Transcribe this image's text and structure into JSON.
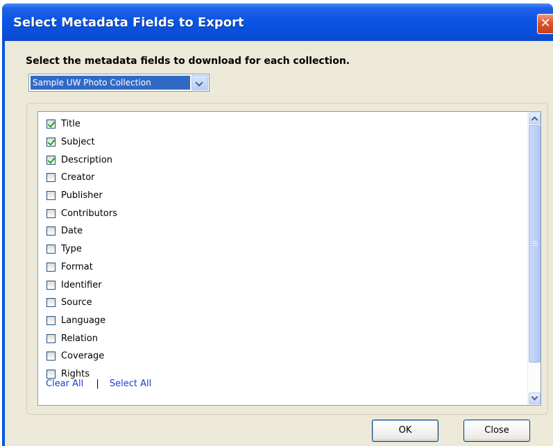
{
  "window": {
    "title": "Select Metadata Fields to Export",
    "close_glyph": "✕"
  },
  "instructions": "Select the metadata fields to download for each collection.",
  "collection_select": {
    "value": "Sample UW Photo Collection"
  },
  "fields": [
    {
      "label": "Title",
      "checked": true
    },
    {
      "label": "Subject",
      "checked": true
    },
    {
      "label": "Description",
      "checked": true
    },
    {
      "label": "Creator",
      "checked": false
    },
    {
      "label": "Publisher",
      "checked": false
    },
    {
      "label": "Contributors",
      "checked": false
    },
    {
      "label": "Date",
      "checked": false
    },
    {
      "label": "Type",
      "checked": false
    },
    {
      "label": "Format",
      "checked": false
    },
    {
      "label": "Identifier",
      "checked": false
    },
    {
      "label": "Source",
      "checked": false
    },
    {
      "label": "Language",
      "checked": false
    },
    {
      "label": "Relation",
      "checked": false
    },
    {
      "label": "Coverage",
      "checked": false
    },
    {
      "label": "Rights",
      "checked": false
    }
  ],
  "links": {
    "clear_all": "Clear All",
    "separator": "|",
    "select_all": "Select All"
  },
  "buttons": {
    "ok": "OK",
    "close": "Close"
  }
}
